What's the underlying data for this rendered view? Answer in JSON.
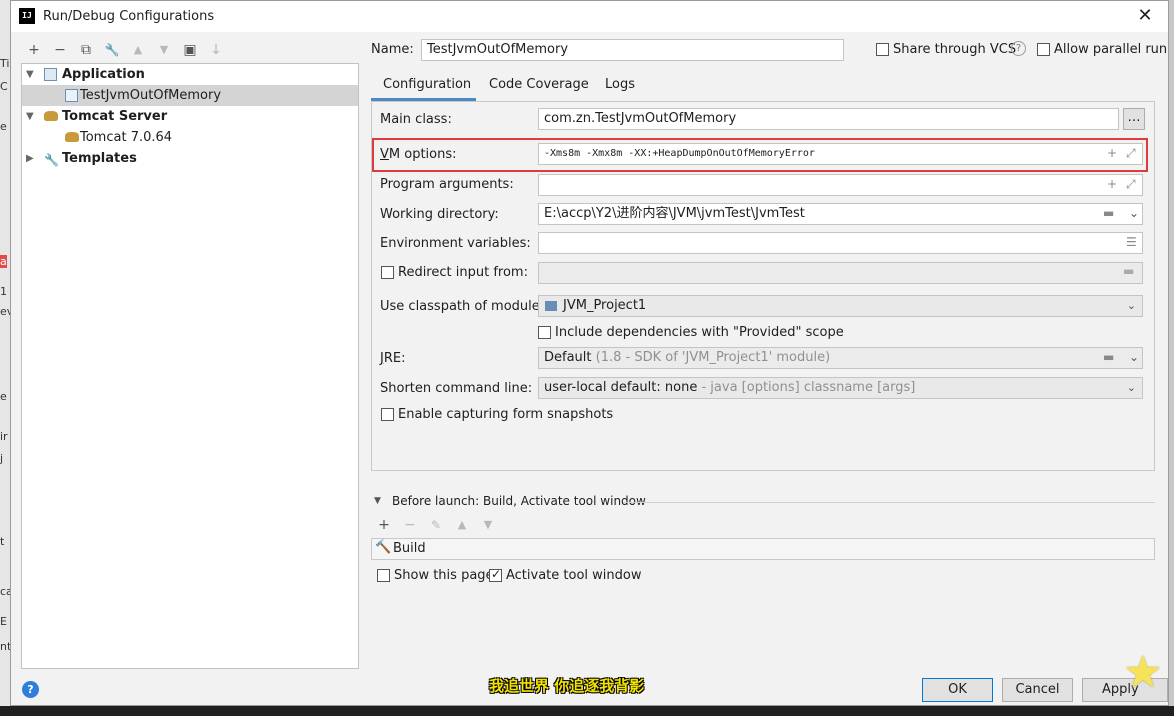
{
  "window": {
    "title": "Run/Debug Configurations",
    "app_icon": "IJ"
  },
  "toolbar": {
    "add": "+",
    "remove": "−",
    "copy": "⧉",
    "edit": "🔧",
    "up": "▲",
    "down": "▼",
    "folder": "▣",
    "sort": "↓"
  },
  "tree": [
    {
      "label": "Application",
      "bold": true,
      "icon": "application-icon",
      "expanded": true
    },
    {
      "label": "TestJvmOutOfMemory",
      "bold": false,
      "icon": "application-config-icon",
      "selected": true
    },
    {
      "label": "Tomcat Server",
      "bold": true,
      "icon": "tomcat-icon",
      "expanded": true
    },
    {
      "label": "Tomcat 7.0.64",
      "bold": false,
      "icon": "tomcat-icon"
    },
    {
      "label": "Templates",
      "bold": true,
      "icon": "wrench-icon",
      "expanded": false
    }
  ],
  "header": {
    "name_label": "Name:",
    "name_value": "TestJvmOutOfMemory",
    "share_vcs": "Share through VCS",
    "allow_parallel": "Allow parallel run"
  },
  "tabs": [
    "Configuration",
    "Code Coverage",
    "Logs"
  ],
  "form": {
    "main_class_label": "Main class:",
    "main_class_value": "com.zn.TestJvmOutOfMemory",
    "vm_options_label": "VM options:",
    "vm_options_value": "-Xms8m -Xmx8m -XX:+HeapDumpOnOutOfMemoryError",
    "program_args_label": "Program arguments:",
    "working_dir_label": "Working directory:",
    "working_dir_value": "E:\\accp\\Y2\\进阶内容\\JVM\\jvmTest\\JvmTest",
    "env_vars_label": "Environment variables:",
    "redirect_input_label": "Redirect input from:",
    "classpath_label": "Use classpath of module:",
    "classpath_value": "JVM_Project1",
    "include_deps_label": "Include dependencies with \"Provided\" scope",
    "jre_label": "JRE:",
    "jre_value": "Default",
    "jre_hint": "(1.8 - SDK of 'JVM_Project1' module)",
    "shorten_label": "Shorten command line:",
    "shorten_value": "user-local default: none",
    "shorten_hint": "- java [options] classname [args]",
    "snapshots_label": "Enable capturing form snapshots"
  },
  "before_launch": {
    "title": "Before launch: Build, Activate tool window",
    "item": "Build",
    "show_page": "Show this page",
    "activate_tool": "Activate tool window"
  },
  "footer": {
    "help": "?",
    "subtitle": "我追世界 你追逐我背影",
    "ok": "OK",
    "cancel": "Cancel",
    "apply": "Apply"
  },
  "colors": {
    "highlight_box": "#e0393e",
    "subtitle": "#f2e200",
    "help": "#2f7ed8"
  },
  "left_strip": [
    "Ti",
    "C",
    "e",
    "a",
    "1",
    "ev",
    "e",
    "ir",
    "j",
    "t",
    "ca",
    "E",
    "nt"
  ]
}
